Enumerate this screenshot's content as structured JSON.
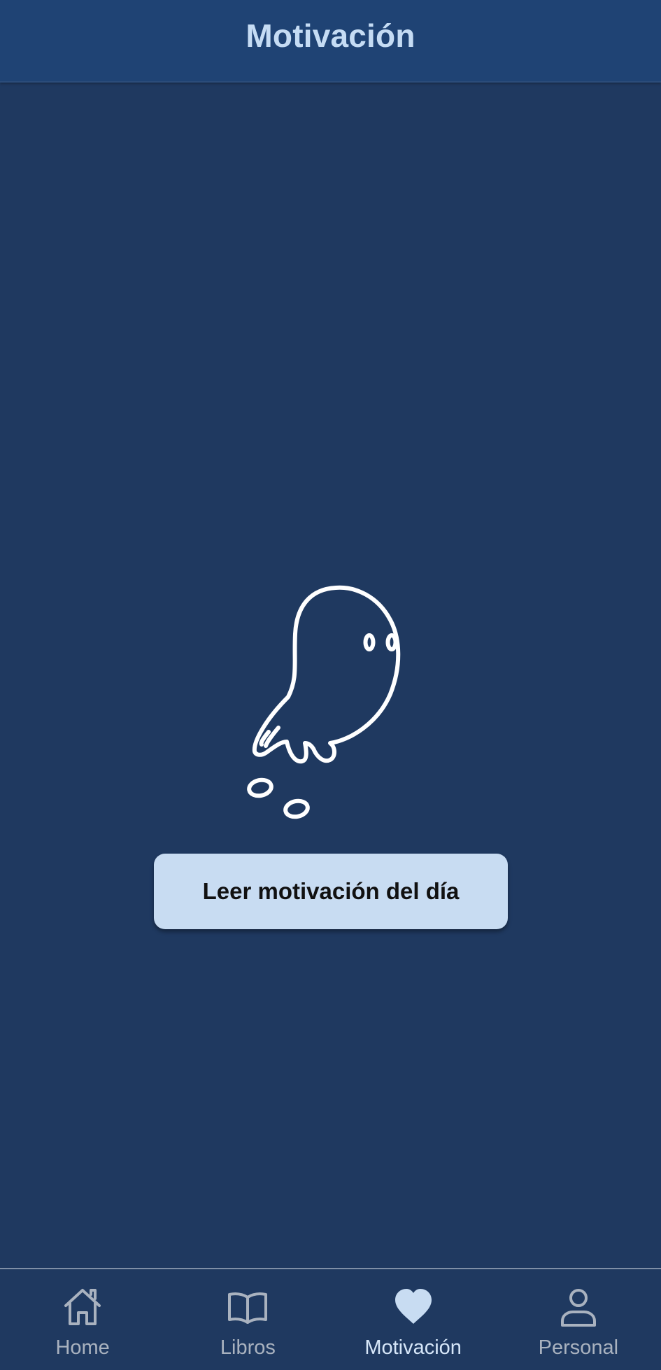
{
  "header": {
    "title": "Motivación"
  },
  "main": {
    "illustration_icon": "ghost-icon",
    "read_button_label": "Leer motivación del día"
  },
  "bottom_nav": {
    "items": [
      {
        "label": "Home",
        "icon": "home-icon",
        "active": false
      },
      {
        "label": "Libros",
        "icon": "book-icon",
        "active": false
      },
      {
        "label": "Motivación",
        "icon": "heart-icon",
        "active": true
      },
      {
        "label": "Personal",
        "icon": "person-icon",
        "active": false
      }
    ]
  },
  "colors": {
    "header_bg": "#1f4374",
    "page_bg": "#1f3960",
    "title_text": "#c5dcf4",
    "button_bg": "#c8dcf2",
    "nav_inactive": "#a9b2bf",
    "nav_active": "#d6e6f8"
  }
}
